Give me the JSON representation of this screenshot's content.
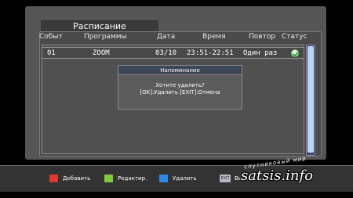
{
  "window": {
    "title": "Расписание"
  },
  "columns": {
    "event": "Событ",
    "program": "Программы",
    "date": "Дата",
    "time": "Время",
    "repeat": "Повтор",
    "status": "Статус"
  },
  "rows": [
    {
      "num": "01",
      "program": "ZOOM",
      "date": "03/10",
      "time": "23:51-22:51",
      "repeat": "Один раз",
      "status": "check-icon"
    }
  ],
  "dialog": {
    "title": "Напоминание",
    "line1": "Хотите удалить?",
    "line2": "[OK]:Удалить [EXIT]:Отмена"
  },
  "footer": {
    "add": "Добавить",
    "edit": "Редактир.",
    "delete": "Удалить",
    "exit_key": "EXIT",
    "exit_label": "Выход"
  },
  "watermark": {
    "top": "спутниковый мир",
    "main": "satsis.info"
  },
  "colors": {
    "red": "#e03a2e",
    "green": "#7fcc3a",
    "blue": "#2c8ae6"
  }
}
